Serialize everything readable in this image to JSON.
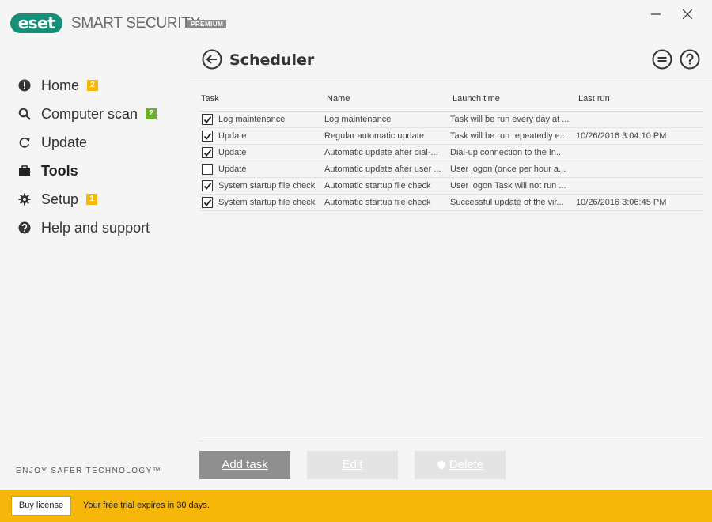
{
  "app": {
    "logo_text": "eset",
    "product_name": "SMART SECURITY",
    "edition": "PREMIUM",
    "accent_color": "#14907a",
    "trial_color": "#f6b60a"
  },
  "sidebar": {
    "items": [
      {
        "label": "Home",
        "icon": "exclamation-circle-icon",
        "badge": "2",
        "badge_color": "#f6b60a"
      },
      {
        "label": "Computer scan",
        "icon": "search-icon",
        "badge": "2",
        "badge_color": "#6ab02f"
      },
      {
        "label": "Update",
        "icon": "refresh-icon",
        "badge": "",
        "badge_color": ""
      },
      {
        "label": "Tools",
        "icon": "toolbox-icon",
        "badge": "",
        "badge_color": "",
        "active": true
      },
      {
        "label": "Setup",
        "icon": "gear-icon",
        "badge": "1",
        "badge_color": "#f6b60a"
      },
      {
        "label": "Help and support",
        "icon": "question-circle-icon",
        "badge": "",
        "badge_color": ""
      }
    ],
    "tagline": "ENJOY SAFER TECHNOLOGY™"
  },
  "main": {
    "title": "Scheduler",
    "columns": [
      "Task",
      "Name",
      "Launch time",
      "Last run"
    ],
    "rows": [
      {
        "checked": true,
        "task": "Log maintenance",
        "name": "Log maintenance",
        "launch": "Task will be run every day at ...",
        "last": ""
      },
      {
        "checked": true,
        "task": "Update",
        "name": "Regular automatic update",
        "launch": "Task will be run repeatedly e...",
        "last": "10/26/2016 3:04:10 PM"
      },
      {
        "checked": true,
        "task": "Update",
        "name": "Automatic update after dial-...",
        "launch": "Dial-up connection to the In...",
        "last": ""
      },
      {
        "checked": false,
        "task": "Update",
        "name": "Automatic update after user ...",
        "launch": "User logon (once per hour a...",
        "last": ""
      },
      {
        "checked": true,
        "task": "System startup file check",
        "name": "Automatic startup file check",
        "launch": "User logon Task will not run ...",
        "last": ""
      },
      {
        "checked": true,
        "task": "System startup file check",
        "name": "Automatic startup file check",
        "launch": "Successful update of the vir...",
        "last": "10/26/2016 3:06:45 PM"
      }
    ],
    "buttons": {
      "add": "Add task",
      "edit": "Edit",
      "delete": "Delete"
    }
  },
  "status_bar": {
    "buy_label": "Buy license",
    "trial_text": "Your free trial expires in 30 days."
  }
}
